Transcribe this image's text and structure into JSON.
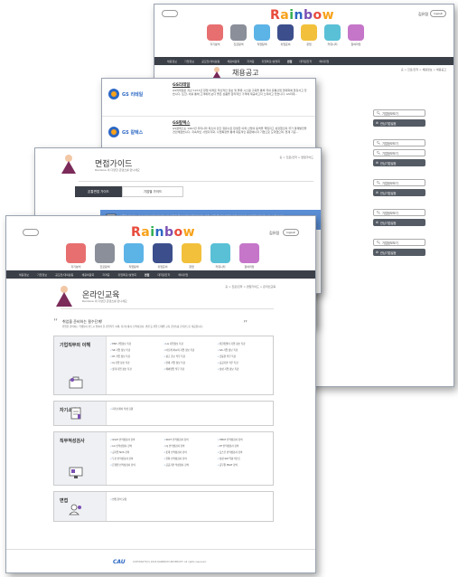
{
  "brand": {
    "logo": "Rainbow",
    "logo_colors": [
      "#e84b3c",
      "#f7a21b",
      "#2fae4f",
      "#2b67c4",
      "#7b4fb3",
      "#e84b3c",
      "#f7a21b"
    ]
  },
  "tiles": [
    {
      "label": "자기분석",
      "color": "#e76f70"
    },
    {
      "label": "진로탐색",
      "color": "#8a8f99"
    },
    {
      "label": "직업탐색",
      "color": "#5cb3e6"
    },
    {
      "label": "취업준비",
      "color": "#3c4f8c"
    },
    {
      "label": "창업",
      "color": "#f2c03b"
    },
    {
      "label": "커뮤니티",
      "color": "#59c0d6"
    },
    {
      "label": "참여마당",
      "color": "#c576c9"
    }
  ],
  "user": {
    "name": "김유림",
    "logout": "logout",
    "login": "login"
  },
  "nav": [
    "채용정보",
    "기업정보",
    "공모전/대외활동",
    "채용박람회",
    "자격증",
    "취업특강/설명회",
    "면접",
    "대학원진학",
    "해외취업"
  ],
  "nav_active": "면접",
  "back_page": {
    "title": "채용공고",
    "breadcrumb": "홈 > 진로/진학 > 채용정보 > 채용공고"
  },
  "companies": [
    {
      "logo": "GS 리테일",
      "name": "GS리테일",
      "desc": "GS리테일은 지난 1971년 창업 이래로 혁신적인 정보 및 물류 시스템 구축을 통해 국내 유통산업 현대화에 앞장서고 있습니다. 또한, 이를 통해 고객에게 보다 좋은 상품을 합리적인 가격에 제공하고자 노력하고 있습니다. GS리테...",
      "btn_view": "기업정보보기",
      "btn_save": "관심기업설정"
    },
    {
      "logo": "GS 칼텍스",
      "name": "GS칼텍스",
      "desc": "GS칼텍스는 1967년 우리나라 최초의 민간 정유사로 탄생한 이래 산업의 동맥을 책임지고 성장했으며 국가 경제발전을 견인해왔습니다. 지속적인 사업다각화, 사업확장을 통해 대표적인 종합에너지 기업으로 도약했으며, 현재 기준...",
      "btn_view": "기업정보보기",
      "btn_save": "관심기업설정"
    }
  ],
  "right_buttons": [
    "기업정보보기",
    "관심기업설정",
    "기업정보보기",
    "기업정보보기",
    "관심기업설정",
    "기업정보보기",
    "관심기업설정",
    "기업정보보기",
    "관심기업설정",
    "기업정보보기",
    "관심기업설정"
  ],
  "interview": {
    "title": "면접가이드",
    "subtitle": "Rainbow 의 다양한 콘텐츠를 만나세요",
    "breadcrumb": "홈 > 진로/진학 > 면접가이드",
    "tabs": [
      "온통면접 가이드",
      "기업별 가이드"
    ],
    "banner": "면접을 대비하는 내 모습을 사전에 점검해 보고 필요한 준비사항을 직접 확인해보세요. 면접 준비에 필요한 모든 가이드와 자료들을 확인해 보실 수 있습니다."
  },
  "online": {
    "title": "온라인교육",
    "subtitle": "Rainbow 의 다양한 콘텐츠를 만나세요",
    "breadcrumb": "홈 > 진로/진학 > 면접가이드 > 온라인교육",
    "quote": "취업을 준비하는 필수단계!",
    "quote_sub": "취업을 준비하는 학생들이 반드시 알아야 할 기업직무 이해, 자기소개서, 인적성검사, 면접 등 취업 단계별 교육 콘텐츠를 온라인으로 제공합니다."
  },
  "sections": [
    {
      "title": "기업직무의 이해",
      "items": [
        "ENT 기업정보 특강",
        "LG 기업정보 특강",
        "유한킴벌리 기업 정보 특강",
        "SK 기업 정보 특강",
        "아모레 퍼시픽 기업 정보 특강",
        "GS 기업 정보 특강",
        "KT 기업 정보 특강",
        "광고 홍보 직무 특강",
        "금융권 직무 특강",
        "CJ 기업 정보 특강",
        "현대 기업 정보 특강",
        "공공기관 직무 특강",
        "롯데 기업 정보 특강",
        "해외영업 직무 특강",
        "삼성 기업 정보 특강"
      ]
    },
    {
      "title": "자기소개서",
      "items": [
        "자기소개서 작성 요령"
      ]
    },
    {
      "title": "직무적성검사",
      "items": [
        "GSAT 인적성검사 강의",
        "SKCT 인적성검사 강의",
        "HMAT 인적성검사 강의",
        "LG 인적성검사 강의",
        "CJ 인적성검사 강의",
        "KT 인적성검사 강의",
        "공기업 NCS 강의",
        "롯데 인적성검사 강의",
        "포스코 인적성검사 강의",
        "두산 인적성검사 강의",
        "한화 인적성검사 강의",
        "삼성 SW 역량 테스트",
        "은행권 인적성검사 강의",
        "공공기관 적성검사 강의",
        "공무원 PSAT 강의"
      ]
    },
    {
      "title": "면접",
      "items": [
        "면접 준비 요령"
      ]
    }
  ],
  "footer": {
    "copyright": "COPYRIGHT(C) 2018 RAINBOW UNIVERSITY. All rights reserved."
  }
}
